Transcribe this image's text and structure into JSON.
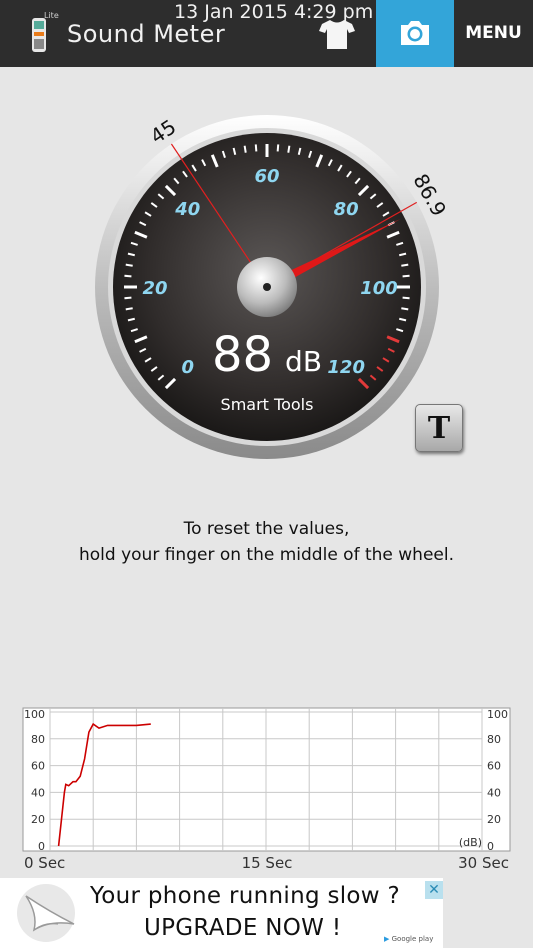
{
  "header": {
    "lite_label": "Lite",
    "title": "Sound Meter",
    "datetime": "13 Jan 2015 4:29 pm",
    "menu_label": "MENU",
    "accent_color": "#33a5d9"
  },
  "icons": {
    "app_icon": "sound-meter-app-icon",
    "shirt": "tshirt-icon",
    "camera": "camera-icon",
    "ad_logo": "bird-logo-icon"
  },
  "gauge": {
    "min": 0,
    "max": 120,
    "scale_labels": [
      "0",
      "20",
      "40",
      "60",
      "80",
      "100",
      "120"
    ],
    "min_marker": "45",
    "max_marker": "86.9",
    "current_value": 88,
    "reading": "88",
    "unit": "dB",
    "brand": "Smart Tools",
    "t_button_label": "T"
  },
  "instructions": {
    "line1": "To reset the values,",
    "line2": "hold your finger on the middle of the wheel."
  },
  "chart_data": {
    "type": "line",
    "ylim": [
      0,
      100
    ],
    "xlim": [
      0,
      30
    ],
    "y_ticks": [
      "100",
      "80",
      "60",
      "40",
      "20",
      "0"
    ],
    "x_ticks": [
      "0 Sec",
      "15 Sec",
      "30 Sec"
    ],
    "unit_label": "(dB)",
    "line_color": "#cc0000",
    "series": [
      {
        "x": [
          0.6,
          0.8,
          1.0,
          1.1,
          1.3,
          1.6,
          1.8,
          2.1,
          2.4,
          2.7,
          3.0,
          3.4,
          4.0,
          5.0,
          6.0,
          7.0
        ],
        "values": [
          0,
          20,
          40,
          46,
          45,
          48,
          48,
          52,
          65,
          85,
          91,
          88,
          90,
          90,
          90,
          91
        ]
      }
    ]
  },
  "ad": {
    "line1": "Your phone running slow ?",
    "line2": "UPGRADE NOW !",
    "badge": "Google play",
    "close_label": "✕"
  }
}
